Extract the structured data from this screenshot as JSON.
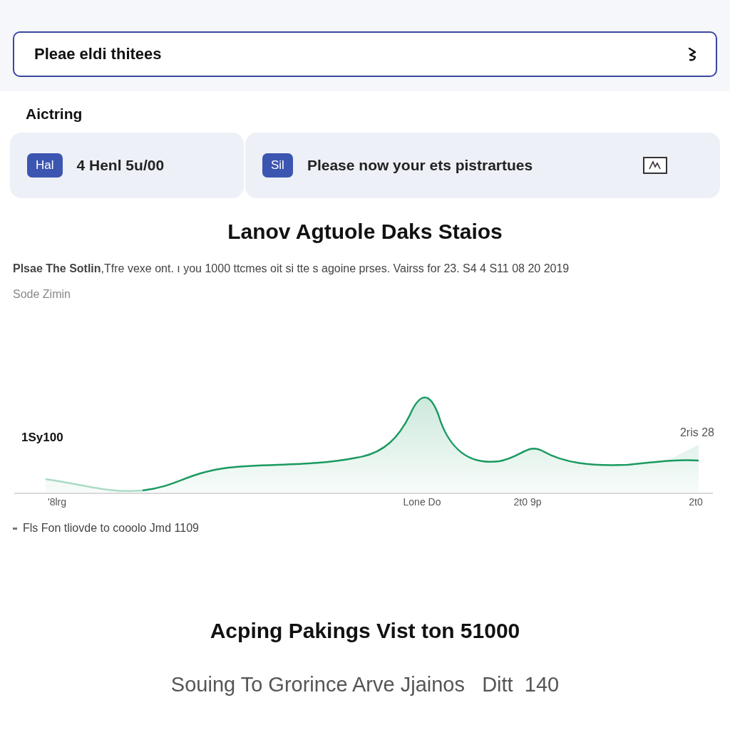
{
  "search": {
    "value": "Pleae eldi thitees"
  },
  "section_title": "Aictring",
  "cards": [
    {
      "badge": "Hal",
      "text": "4 Henl 5u/00",
      "has_icon": false
    },
    {
      "badge": "Sil",
      "text": "Please now your ets pistrartues",
      "has_icon": true
    }
  ],
  "heading": "Lanov Agtuole Daks Staios",
  "description": "**Plsae The Sotlin**,Tfre vexe ont. ı you 1000 ttcmes oit si tte s agoine prses. Vairss for 23. S4 4 S11 08 20 2019",
  "subtitle": "Sode Zimin",
  "chart": {
    "y_label": "1Sy100",
    "end_label": "2ris 28",
    "x_labels": [
      "'8lrg",
      "Lone Do",
      "2t0 9p",
      "2t0"
    ],
    "legend": "Fls Fon tliovde to cooolo Jmd 1109"
  },
  "footer": {
    "title": "Acping Pakings Vist ton 51000",
    "line": "Souing To Grorince Arve Jjainos   Ditt  140"
  }
}
